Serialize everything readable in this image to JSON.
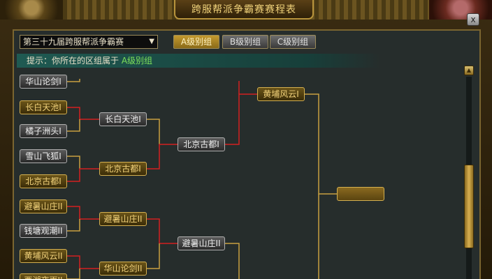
{
  "window": {
    "title": "跨服帮派争霸赛赛程表",
    "close_label": "x"
  },
  "season_select": {
    "value": "第三十九届跨服帮派争霸赛",
    "arrow": "▼"
  },
  "tabs": [
    {
      "label": "A级别组",
      "active": true
    },
    {
      "label": "B级别组",
      "active": false
    },
    {
      "label": "C级别组",
      "active": false
    }
  ],
  "hint": {
    "prefix": "提示：你所在的区组属于",
    "group": "A级别组"
  },
  "scroll": {
    "up_glyph": "▲"
  },
  "bracket": {
    "round1": [
      {
        "name": "华山论剑I",
        "style": "gray"
      },
      {
        "name": "长白天池I",
        "style": "gold"
      },
      {
        "name": "橘子洲头I",
        "style": "gray"
      },
      {
        "name": "雪山飞狐I",
        "style": "gray"
      },
      {
        "name": "北京古都I",
        "style": "gold"
      },
      {
        "name": "避暑山庄II",
        "style": "gold"
      },
      {
        "name": "钱塘观潮II",
        "style": "gray"
      },
      {
        "name": "黄埔风云II",
        "style": "gold"
      },
      {
        "name": "西湖夜雨II",
        "style": "gold"
      }
    ],
    "round2": [
      {
        "name": "长白天池I",
        "style": "gray"
      },
      {
        "name": "北京古都I",
        "style": "gold"
      },
      {
        "name": "避暑山庄II",
        "style": "gold"
      },
      {
        "name": "华山论剑II",
        "style": "gold"
      }
    ],
    "round3": [
      {
        "name": "北京古都I",
        "style": "gray"
      },
      {
        "name": "避暑山庄II",
        "style": "gray"
      }
    ],
    "round4": [
      {
        "name": "黄埔风云I",
        "style": "gold"
      }
    ],
    "final": {
      "name": ""
    }
  },
  "colors": {
    "winner_line": "#d42020",
    "loser_line": "#c8a040"
  }
}
